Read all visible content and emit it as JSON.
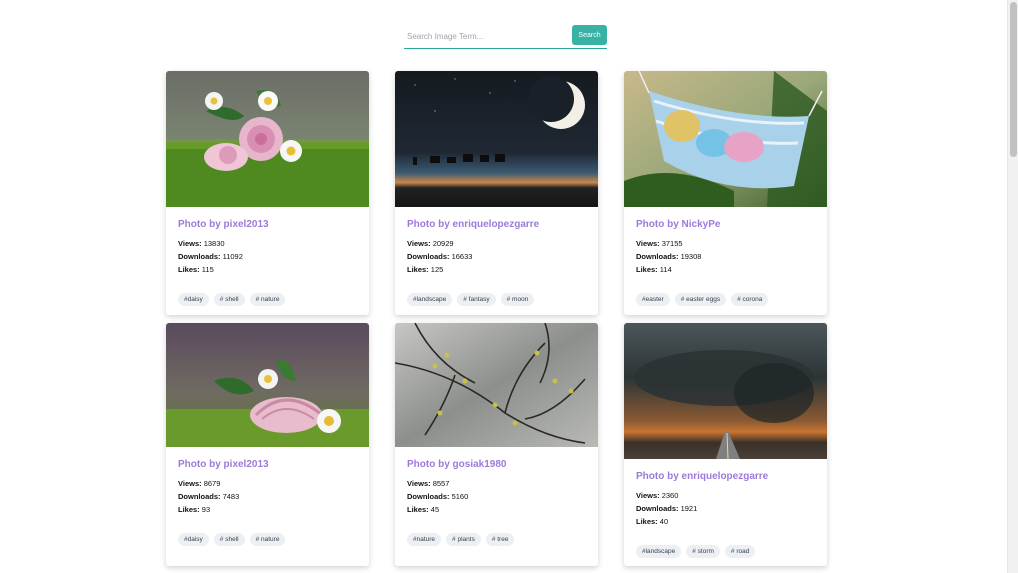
{
  "search": {
    "placeholder": "Search Image Term...",
    "button_label": "Search"
  },
  "labels": {
    "views": "Views:",
    "downloads": "Downloads:",
    "likes": "Likes:"
  },
  "cards": [
    {
      "title": "Photo by pixel2013",
      "views": "13830",
      "downloads": "11092",
      "likes": "115",
      "tags": [
        "#daisy",
        "# shell",
        "# nature"
      ],
      "image": "snail-shell-daisies"
    },
    {
      "title": "Photo by enriquelopezgarre",
      "views": "20929",
      "downloads": "16633",
      "likes": "125",
      "tags": [
        "#landscape",
        "# fantasy",
        "# moon"
      ],
      "image": "desert-caravan-moon"
    },
    {
      "title": "Photo by NickyPe",
      "views": "37155",
      "downloads": "19308",
      "likes": "114",
      "tags": [
        "#easter",
        "# easter eggs",
        "# corona"
      ],
      "image": "easter-eggs-in-mask"
    },
    {
      "title": "Photo by pixel2013",
      "views": "8679",
      "downloads": "7483",
      "likes": "93",
      "tags": [
        "#daisy",
        "# shell",
        "# nature"
      ],
      "image": "shell-daisies-moss"
    },
    {
      "title": "Photo by gosiak1980",
      "views": "8557",
      "downloads": "5160",
      "likes": "45",
      "tags": [
        "#nature",
        "# plants",
        "# tree"
      ],
      "image": "budding-branches"
    },
    {
      "title": "Photo by enriquelopezgarre",
      "views": "2360",
      "downloads": "1921",
      "likes": "40",
      "tags": [
        "#landscape",
        "# storm",
        "# road"
      ],
      "image": "storm-over-road"
    }
  ],
  "colors": {
    "accent": "#37b2a4",
    "title": "#9b7ad9",
    "tag_bg": "#edf0f3"
  }
}
